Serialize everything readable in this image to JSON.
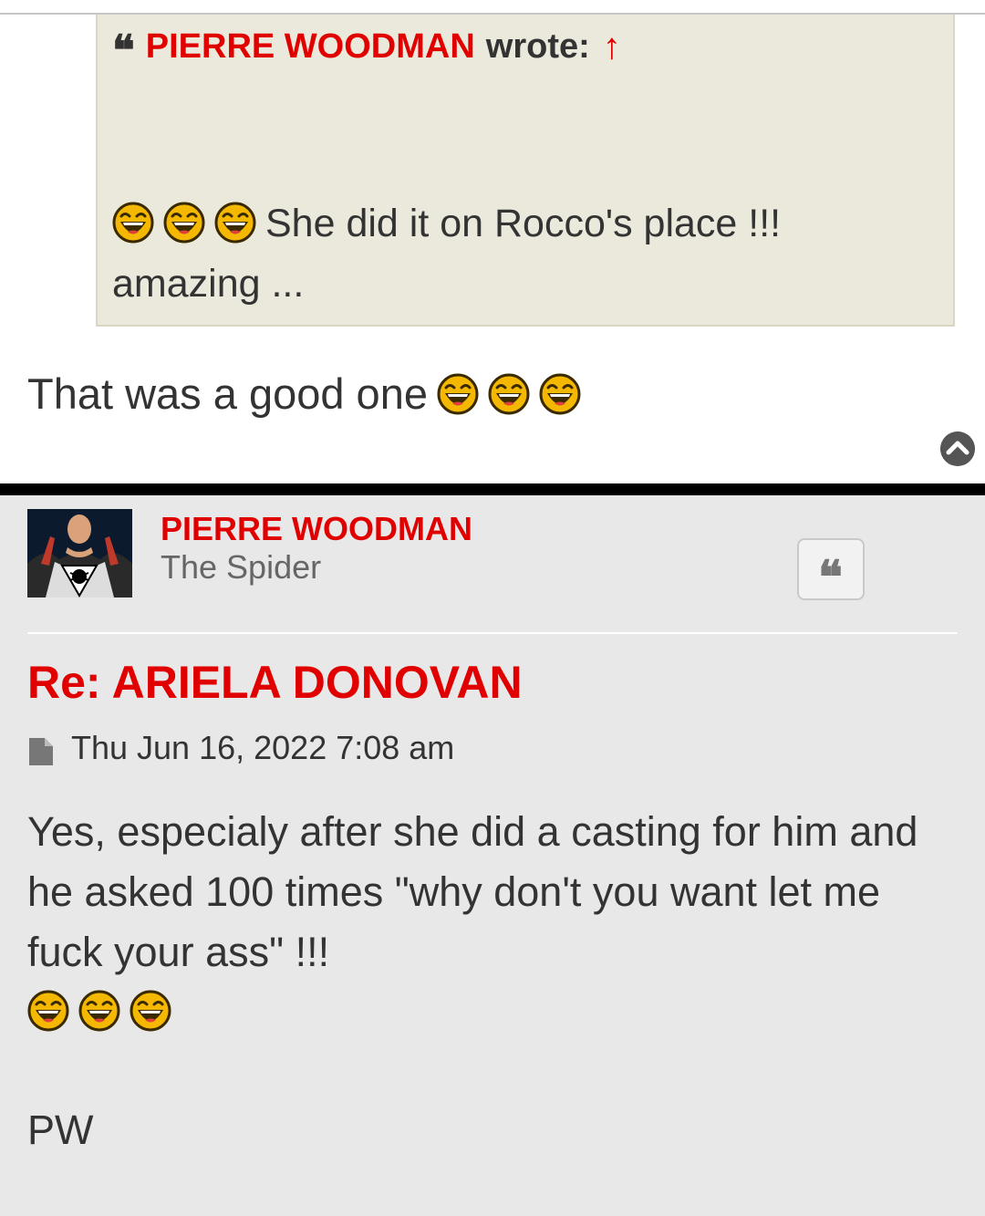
{
  "quote": {
    "author": "PIERRE WOODMAN",
    "wrote": "wrote:",
    "arrow": "↑",
    "text_line1": "She did it on Rocco's place !!!",
    "text_line2": "amazing ..."
  },
  "reply1": {
    "text": "That was a good one"
  },
  "post": {
    "author": "PIERRE WOODMAN",
    "rank": "The Spider",
    "title": "Re: ARIELA DONOVAN",
    "date": "Thu Jun 16, 2022 7:08 am",
    "body": "Yes, especialy after she did a casting for him and he asked 100 times \"why don't you want let me fuck your ass\" !!!",
    "signature": "PW"
  },
  "icons": {
    "quote_mark": "❝",
    "smiley": "laughing-smiley-icon",
    "back_to_top": "chevron-up-icon",
    "file": "file-icon"
  },
  "colors": {
    "accent": "#e00000",
    "quote_bg": "#ebe9dc",
    "post_bg": "#e8e8e8",
    "text": "#333333"
  }
}
